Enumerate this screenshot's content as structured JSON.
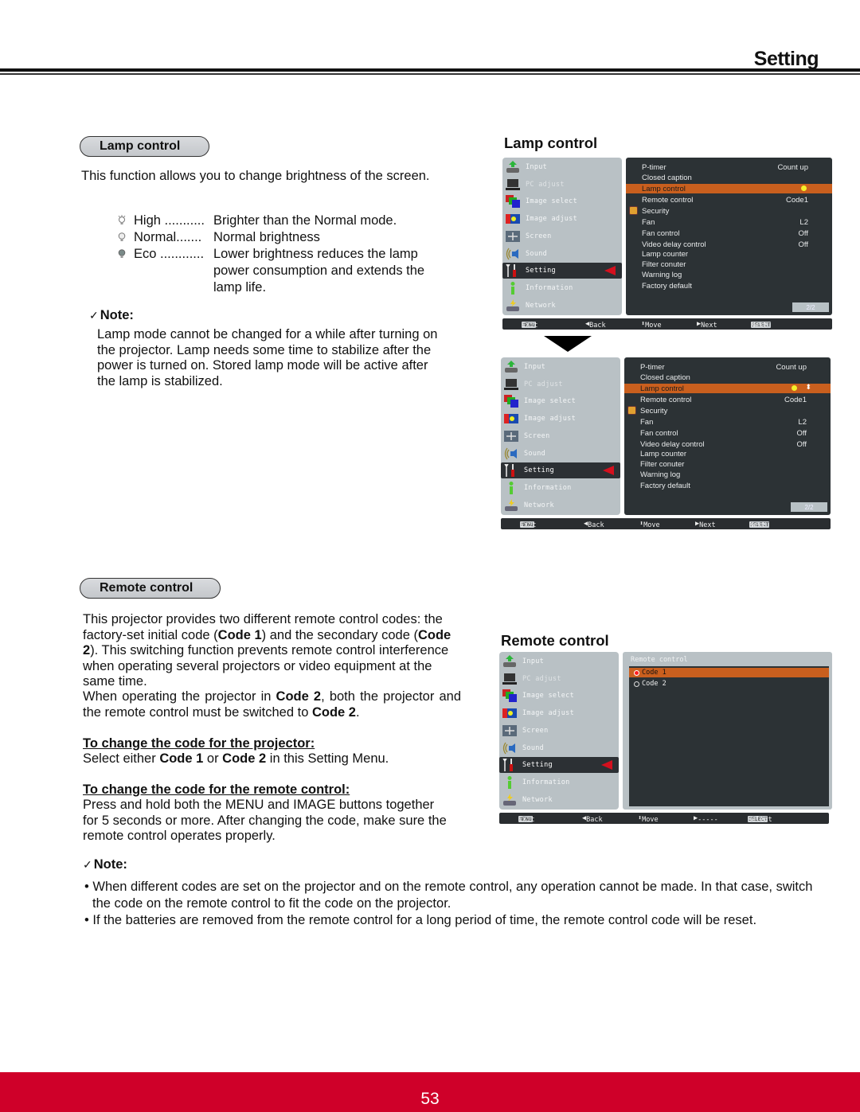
{
  "header": {
    "section_title": "Setting"
  },
  "lamp_section": {
    "pill_label": "Lamp control",
    "intro": "This function allows you to change brightness of the screen.",
    "modes": [
      {
        "icon": "lamp-high-icon",
        "name": "High ...........",
        "desc": "Brighter than the Normal mode."
      },
      {
        "icon": "lamp-normal-icon",
        "name": "Normal.......",
        "desc": "Normal brightness"
      },
      {
        "icon": "lamp-eco-icon",
        "name": "Eco ............",
        "desc": "Lower brightness reduces the lamp power consumption and extends the lamp life."
      }
    ],
    "note_label": "Note:",
    "note_text": "Lamp mode cannot be changed for a while after turning on the projector. Lamp needs some time to stabilize after the power is turned on. Stored lamp mode will be active after the lamp is stabilized."
  },
  "lamp_figure": {
    "title": "Lamp control",
    "menu_items": [
      {
        "label": "Input",
        "icon": "input-icon"
      },
      {
        "label": "PC adjust",
        "icon": "pc-adjust-icon"
      },
      {
        "label": "Image select",
        "icon": "image-select-icon"
      },
      {
        "label": "Image adjust",
        "icon": "image-adjust-icon"
      },
      {
        "label": "Screen",
        "icon": "screen-icon"
      },
      {
        "label": "Sound",
        "icon": "sound-icon"
      },
      {
        "label": "Setting",
        "icon": "setting-icon"
      },
      {
        "label": "Information",
        "icon": "information-icon"
      },
      {
        "label": "Network",
        "icon": "network-icon"
      }
    ],
    "settings_rows": [
      {
        "label": "P-timer",
        "value": "Count up"
      },
      {
        "label": "Closed caption",
        "value": ""
      },
      {
        "label": "Lamp control",
        "value": ""
      },
      {
        "label": "Remote control",
        "value": "Code1"
      },
      {
        "label": "Security",
        "value": ""
      },
      {
        "label": "Fan",
        "value": "L2"
      },
      {
        "label": "Fan control",
        "value": "Off"
      },
      {
        "label": "Video delay control",
        "value": "Off"
      },
      {
        "label": "Lamp counter",
        "value": ""
      },
      {
        "label": "Filter conuter",
        "value": ""
      },
      {
        "label": "Warning log",
        "value": ""
      },
      {
        "label": "Factory default",
        "value": ""
      }
    ],
    "page_indicator": "2/2",
    "bottom_bar": {
      "menu_key": "MENU",
      "exit": "Exit",
      "back": "Back",
      "move": "Move",
      "next": "Next",
      "select_key": "SELECT",
      "select_action": "Next"
    }
  },
  "remote_section": {
    "pill_label": "Remote control",
    "p1_a": "This projector provides two different remote control codes: the factory-set initial code (",
    "p1_code1": "Code 1",
    "p1_b": ") and the secondary code (",
    "p1_code2": "Code 2",
    "p1_c": "). This switching function prevents remote control interference when operating several projectors or video equipment at the same time.",
    "p2_a": "When operating the projector in ",
    "p2_code2": "Code 2",
    "p2_b": ", both the projector and the remote control must be switched to ",
    "p2_code2b": "Code 2",
    "p2_c": ".",
    "proj_heading": "To change the code for the projector:",
    "proj_a": "Select either ",
    "proj_code1": "Code 1",
    "proj_or": " or ",
    "proj_code2": "Code 2",
    "proj_b": " in this Setting Menu.",
    "remote_heading": "To change the code for the remote control:",
    "remote_text": "Press and hold both the MENU and IMAGE buttons together for 5 seconds or more.  After changing the code, make sure the  remote control operates properly.",
    "note_label": "Note:",
    "notes": [
      "When different codes are set on the projector and on the remote control, any operation cannot be made. In that case, switch the code on the remote control to fit the code on the projector.",
      "If the batteries are removed from the remote control for a long period of time, the remote control code will be reset."
    ]
  },
  "remote_figure": {
    "title": "Remote control",
    "submenu_title": "Remote control",
    "options": [
      {
        "label": "Code 1",
        "selected": true
      },
      {
        "label": "Code 2",
        "selected": false
      }
    ],
    "bottom_bar": {
      "menu_key": "MENU",
      "exit": "Exit",
      "back": "Back",
      "move": "Move",
      "next": "-----",
      "select_key": "SELECT",
      "select_action": "Select"
    }
  },
  "footer": {
    "page_number": "53",
    "color": "#cf0029"
  },
  "colors": {
    "osd_selected": "#c95f1e",
    "osd_panel": "#2c3235",
    "osd_sidebar": "#b9c1c5",
    "pointer_red": "#d4101e"
  }
}
